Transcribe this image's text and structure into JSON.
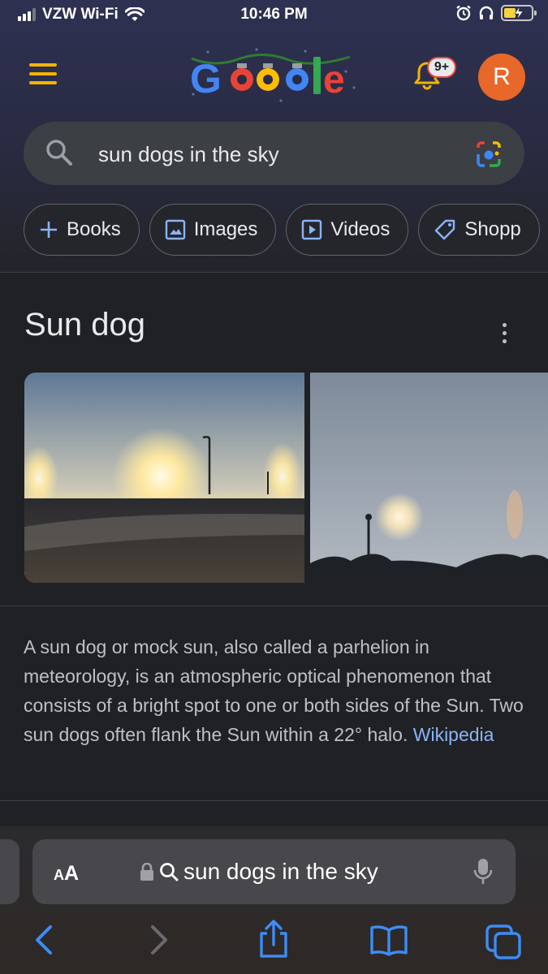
{
  "status_bar": {
    "carrier": "VZW Wi-Fi",
    "time": "10:46 PM",
    "icons": [
      "signal-icon",
      "wifi-icon",
      "alarm-icon",
      "headphones-icon",
      "battery-charging-icon"
    ]
  },
  "header": {
    "logo_text": "Google",
    "notification_count": "9+",
    "avatar_initial": "R"
  },
  "search": {
    "query": "sun dogs in the sky",
    "icons": [
      "search-icon",
      "camera-lens-icon"
    ]
  },
  "chips": [
    {
      "label": "Books",
      "icon": "plus-icon"
    },
    {
      "label": "Images",
      "icon": "image-icon"
    },
    {
      "label": "Videos",
      "icon": "play-icon"
    },
    {
      "label": "Shopp",
      "icon": "tag-icon"
    }
  ],
  "knowledge_panel": {
    "title": "Sun dog",
    "description": "A sun dog or mock sun, also called a parhelion in meteorology, is an atmospheric optical phenomenon that consists of a bright spot to one or both sides of the Sun. Two sun dogs often flank the Sun within a 22° halo.",
    "source": "Wikipedia"
  },
  "safari": {
    "text_size_label_small": "A",
    "text_size_label_big": "A",
    "url_text": "sun dogs in the sky",
    "toolbar": [
      "back-icon",
      "forward-icon",
      "share-icon",
      "bookmarks-icon",
      "tabs-icon"
    ]
  },
  "colors": {
    "background": "#202124",
    "accent_link": "#8ab4f8",
    "menu_icon": "#f3b400",
    "avatar": "#e8682a",
    "safari_accent": "#3d8cf5"
  }
}
